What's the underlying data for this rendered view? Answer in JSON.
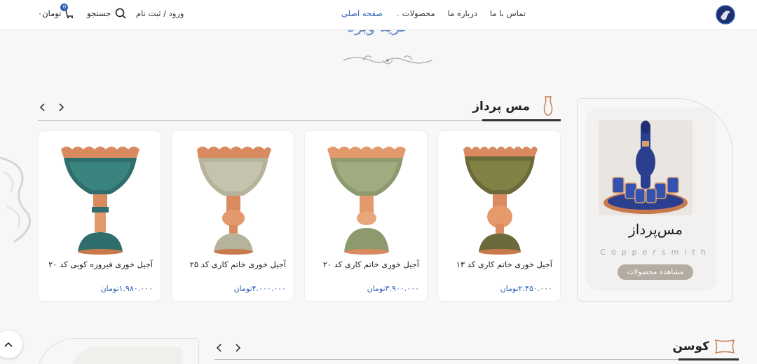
{
  "header": {
    "nav": [
      {
        "label": "صفحه اصلی",
        "active": true
      },
      {
        "label": "محصولات",
        "dropdown": true
      },
      {
        "label": "درباره ما"
      },
      {
        "label": "تماس با ما"
      }
    ],
    "login_label": "ورود / ثبت نام",
    "search_label": "جستجو",
    "cart_count": "0",
    "cart_total": "۰تومان"
  },
  "section": {
    "title": "خرید ویژه"
  },
  "category": {
    "title": "مس پرداز",
    "card_name": "مس‌پرداز",
    "card_en": "Coppersmith",
    "button_label": "مشاهده محصولات"
  },
  "products": [
    {
      "name": "آجیل خوری خاتم کاری کد ۱۳",
      "price": "۲.۴۵۰.۰۰۰تومان",
      "style": "khatam-dark"
    },
    {
      "name": "آجیل خوری خاتم کاری کد ۲۰",
      "price": "۳.۹۰۰.۰۰۰تومان",
      "style": "khatam-green"
    },
    {
      "name": "آجیل خوری خاتم کاری کد ۲۵",
      "price": "۴.۰۰۰.۰۰۰تومان",
      "style": "khatam-light"
    },
    {
      "name": "آجیل خوری فیروزه کوبی کد ۲۰",
      "price": "۱.۹۸۰.۰۰۰تومان",
      "style": "turquoise"
    }
  ],
  "category2": {
    "title": "کوسن"
  },
  "colors": {
    "accent": "#2d62b3",
    "copper": "#d98b5f",
    "button": "#b4aca3"
  }
}
